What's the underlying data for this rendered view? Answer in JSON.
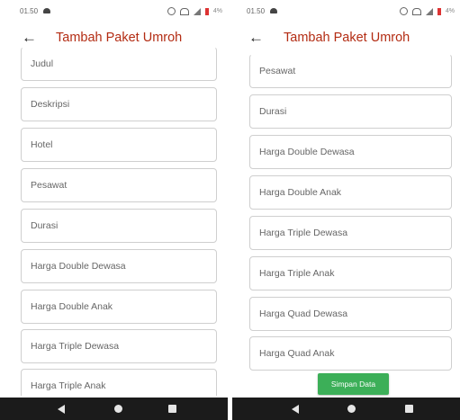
{
  "status": {
    "time": "01.50",
    "battery": "4%"
  },
  "app": {
    "title": "Tambah Paket Umroh"
  },
  "left_fields": [
    "Judul",
    "Deskripsi",
    "Hotel",
    "Pesawat",
    "Durasi",
    "Harga Double Dewasa",
    "Harga Double Anak",
    "Harga Triple Dewasa",
    "Harga Triple Anak"
  ],
  "right_fields": [
    "Pesawat",
    "Durasi",
    "Harga Double Dewasa",
    "Harga Double Anak",
    "Harga Triple Dewasa",
    "Harga Triple Anak",
    "Harga Quad Dewasa",
    "Harga Quad Anak"
  ],
  "save_button": {
    "label": "Simpan Data",
    "color": "#3caf58"
  },
  "colors": {
    "title": "#b32c13",
    "navbar": "#1b1b1b"
  },
  "icons": [
    "back-arrow-icon",
    "alarm-icon",
    "signal-icon",
    "battery-icon",
    "nav-back-icon",
    "nav-home-icon",
    "nav-recent-icon"
  ]
}
